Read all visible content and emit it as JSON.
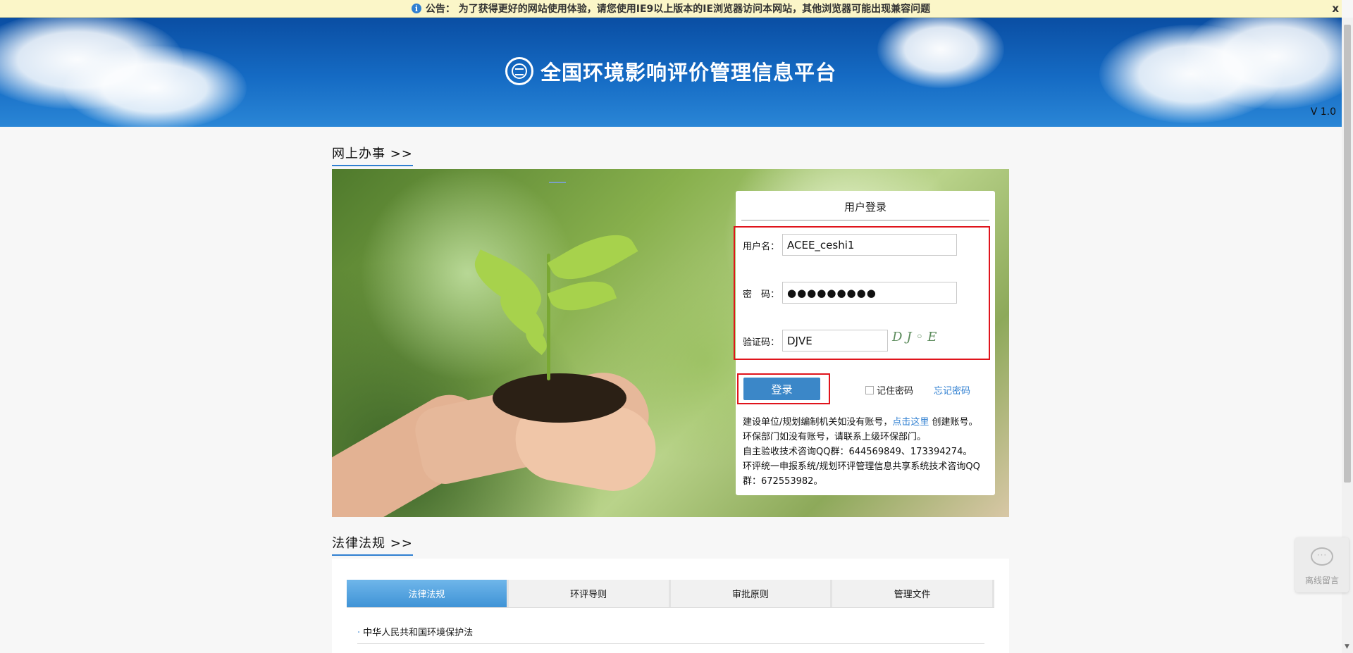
{
  "notice": {
    "icon": "info-icon",
    "text": "公告： 为了获得更好的网站使用体验，请您使用IE9以上版本的IE浏览器访问本网站，其他浏览器可能出现兼容问题",
    "close": "x"
  },
  "header": {
    "title": "全国环境影响评价管理信息平台",
    "version": "V 1.0"
  },
  "sections": {
    "online": "网上办事 >>",
    "laws": "法律法规 >>"
  },
  "login": {
    "title": "用户登录",
    "username_label": "用户名：",
    "username_value": "ACEE_ceshi1",
    "password_label": "密　码：",
    "password_value": "●●●●●●●●●",
    "captcha_label": "验证码：",
    "captcha_value": "DJVE",
    "captcha_image_text": "DJ◦E",
    "submit": "登录",
    "remember": "记住密码",
    "forgot": "忘记密码",
    "info_line1_prefix": "建设单位/规划编制机关如没有账号，",
    "info_line1_link": "点击这里",
    "info_line1_suffix": " 创建账号。",
    "info_line2": "环保部门如没有账号，请联系上级环保部门。",
    "info_line3": "自主验收技术咨询QQ群：644569849、173394274。",
    "info_line4": "环评统一申报系统/规划环评管理信息共享系统技术咨询QQ群：672553982。"
  },
  "laws": {
    "tabs": [
      "法律法规",
      "环评导则",
      "审批原则",
      "管理文件"
    ],
    "items": [
      "中华人民共和国环境保护法"
    ]
  },
  "widget": {
    "label": "离线留言",
    "icon": "chat-bubble-icon"
  },
  "colors": {
    "accent": "#2f7fd1",
    "header_blue": "#0a4ea3",
    "highlight_red": "#e0141c",
    "notice_bg": "#fbf6c8"
  }
}
